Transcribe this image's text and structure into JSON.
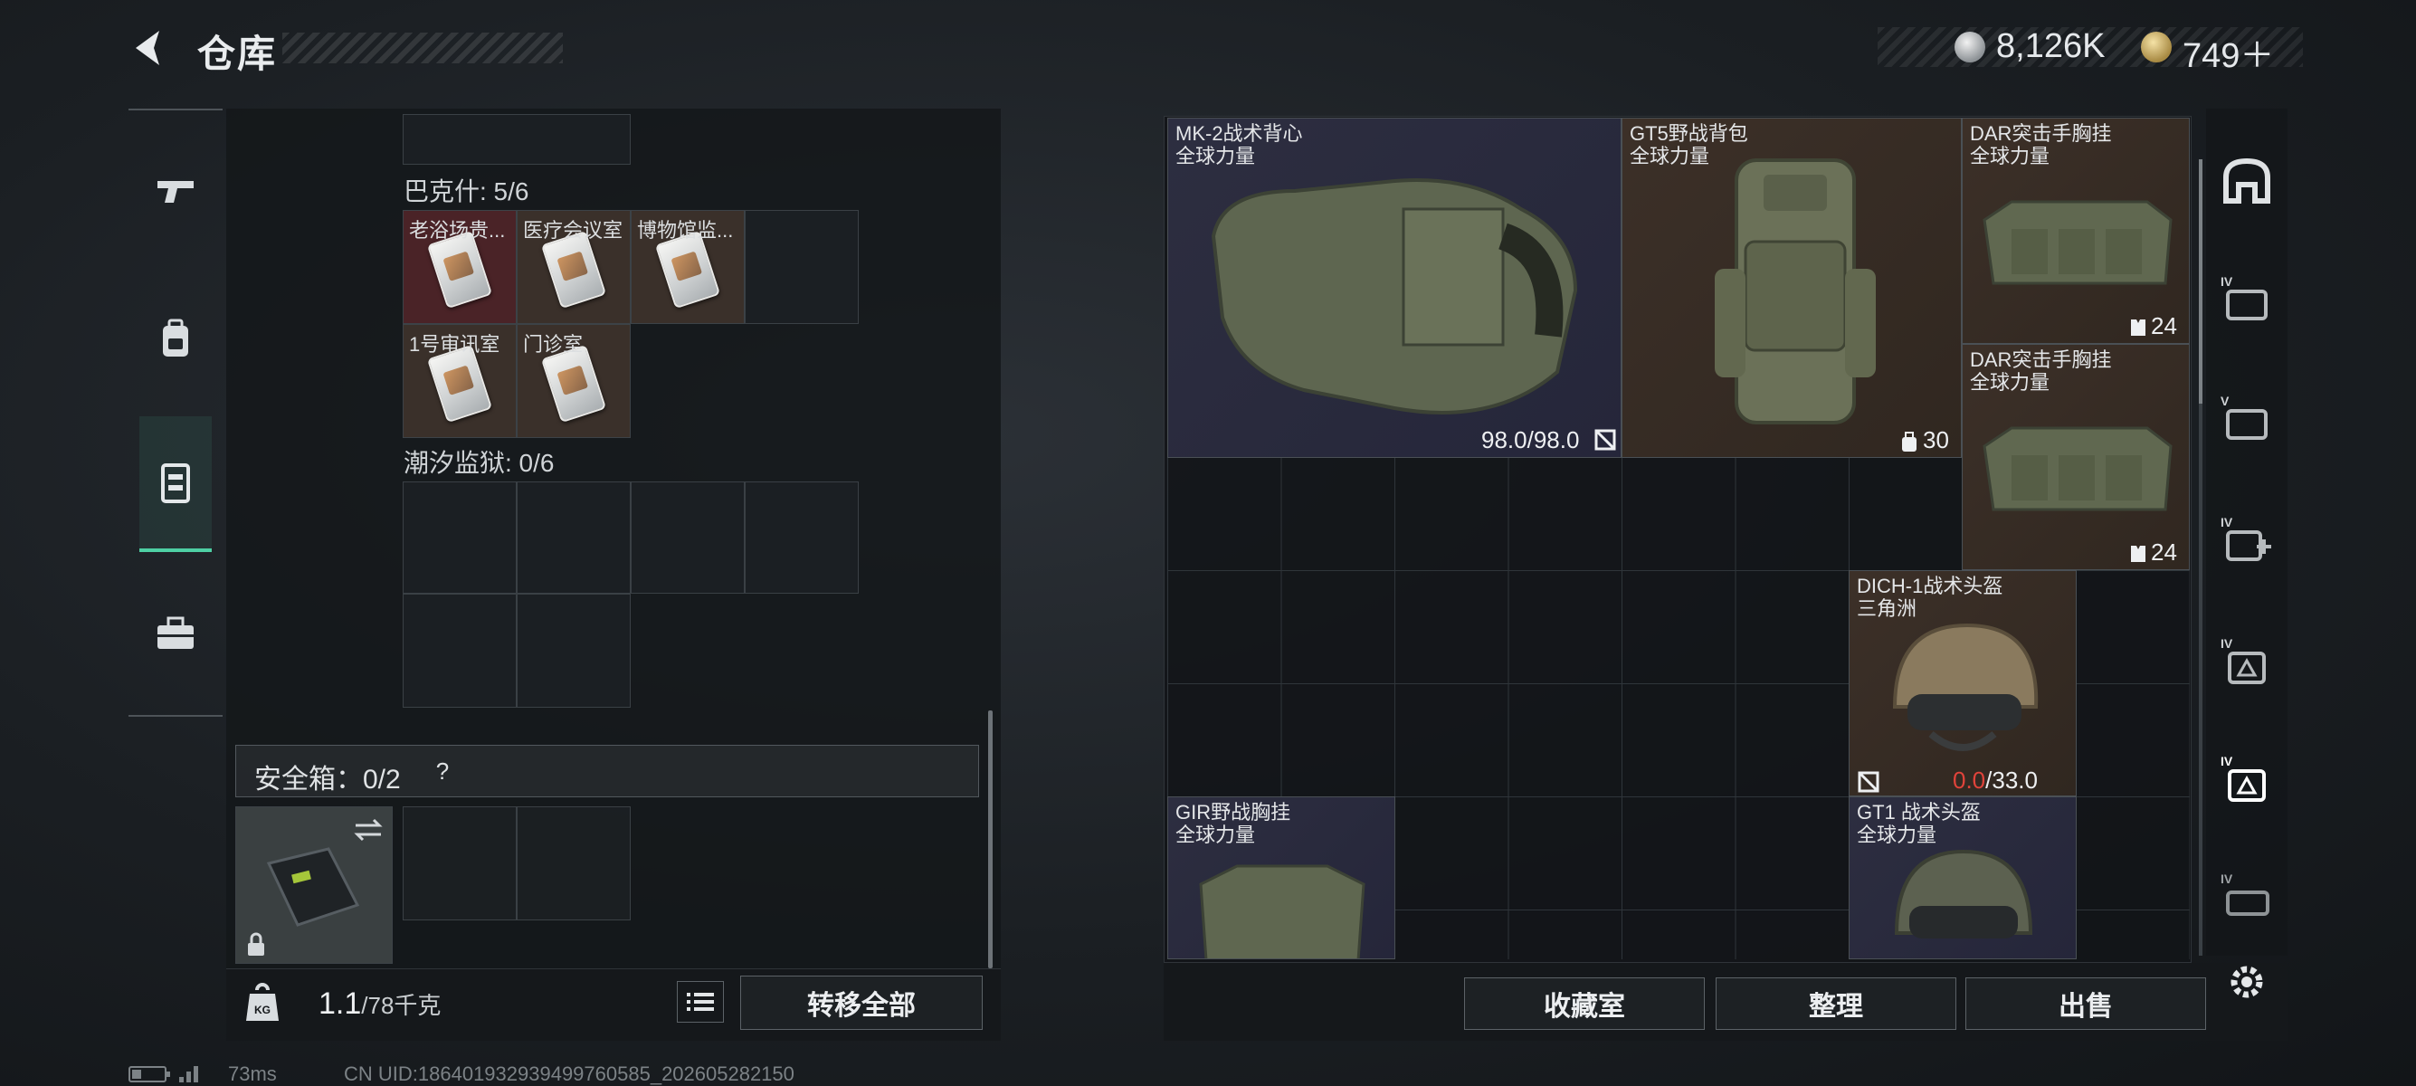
{
  "header": {
    "title": "仓库",
    "currency_silver": "8,126K",
    "currency_gold": "749＋"
  },
  "tabs": [
    {
      "name": "weapons"
    },
    {
      "name": "equipment"
    },
    {
      "name": "containers",
      "active": true
    },
    {
      "name": "supplies"
    }
  ],
  "stash": {
    "section1_label": "巴克什: 5/6",
    "keys": [
      "老浴场贵...",
      "医疗会议室",
      "博物馆监...",
      "1号审讯室",
      "门诊室"
    ],
    "section2_label": "潮汐监狱: 0/6",
    "safe_label": "安全箱：0/2",
    "safe_help": "?",
    "weight_current": "1.1",
    "weight_max": "/78千克",
    "transfer_all": "转移全部"
  },
  "inventory": {
    "items": [
      {
        "name": "MK-2战术背心",
        "sub": "全球力量",
        "value": "98.0/98.0",
        "icon": "no-repair-icon"
      },
      {
        "name": "GT5野战背包",
        "sub": "全球力量",
        "value": "30",
        "icon": "capacity-icon"
      },
      {
        "name": "DAR突击手胸挂",
        "sub": "全球力量",
        "value": "24",
        "icon": "capacity-icon"
      },
      {
        "name": "DAR突击手胸挂",
        "sub": "全球力量",
        "value": "24",
        "icon": "capacity-icon"
      },
      {
        "name": "DICH-1战术头盔",
        "sub": "三角洲",
        "value_red": "0.0",
        "value_rest": "/33.0",
        "icon": "no-repair-icon"
      },
      {
        "name": "GIR野战胸挂",
        "sub": "全球力量"
      },
      {
        "name": "GT1 战术头盔",
        "sub": "全球力量"
      }
    ],
    "buttons": {
      "collection": "收藏室",
      "sort": "整理",
      "sell": "出售"
    }
  },
  "side_filters": [
    "helmet-filter",
    "armor-lv-iv",
    "armor-lv-v",
    "medical-lv-iv",
    "backpack-lv-iv",
    "backpack-lv-iv-active",
    "chestrig-lv-iv"
  ],
  "status_bar": {
    "ping": "73ms",
    "uid": "CN UID:1864019329394997605​85_202605282150"
  },
  "colors": {
    "accent": "#4ed0a4",
    "warning_red": "#e0433a"
  }
}
